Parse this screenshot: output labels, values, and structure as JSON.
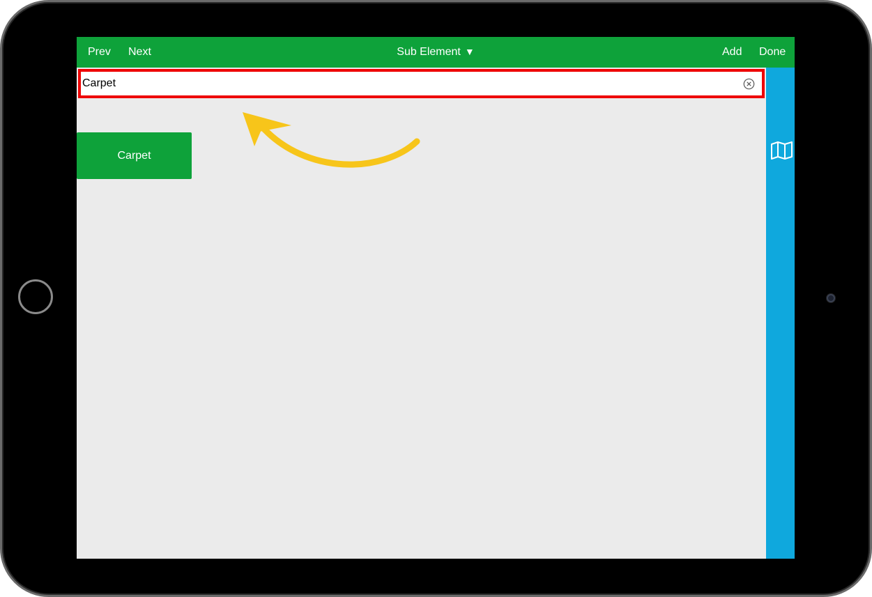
{
  "navbar": {
    "prev_label": "Prev",
    "next_label": "Next",
    "title": "Sub Element",
    "title_arrow": "▼",
    "add_label": "Add",
    "done_label": "Done"
  },
  "search": {
    "value": "Carpet"
  },
  "results": [
    {
      "label": "Carpet"
    }
  ],
  "colors": {
    "navbar": "#0ea23a",
    "sidebar": "#0fa8dd",
    "highlight_border": "#ee0000",
    "annotation_arrow": "#f7c51a",
    "content_background": "#ebebeb"
  },
  "icons": {
    "clear": "clear-circle-x-icon",
    "sidebar": "map-icon",
    "annotation": "curved-arrow-icon"
  }
}
